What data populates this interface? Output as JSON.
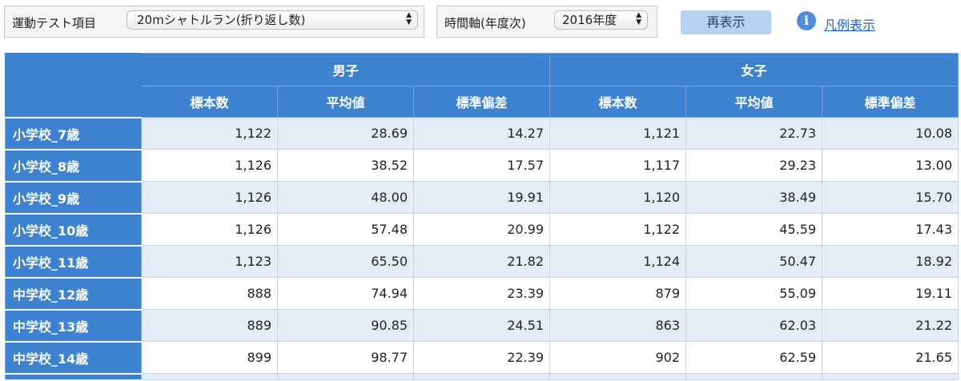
{
  "toolbar": {
    "test_item_label": "運動テスト項目",
    "test_item_value": "20mシャトルラン(折り返し数)",
    "time_axis_label": "時間軸(年度次)",
    "time_axis_value": "2016年度",
    "refresh_label": "再表示",
    "legend_label": "凡例表示",
    "info_glyph": "i"
  },
  "table": {
    "groups": [
      "男子",
      "女子"
    ],
    "columns": [
      "標本数",
      "平均値",
      "標準偏差",
      "標本数",
      "平均値",
      "標準偏差"
    ],
    "rows": [
      {
        "label": "小学校_7歳",
        "cells": [
          "1,122",
          "28.69",
          "14.27",
          "1,121",
          "22.73",
          "10.08"
        ]
      },
      {
        "label": "小学校_8歳",
        "cells": [
          "1,126",
          "38.52",
          "17.57",
          "1,117",
          "29.23",
          "13.00"
        ]
      },
      {
        "label": "小学校_9歳",
        "cells": [
          "1,126",
          "48.00",
          "19.91",
          "1,120",
          "38.49",
          "15.70"
        ]
      },
      {
        "label": "小学校_10歳",
        "cells": [
          "1,126",
          "57.48",
          "20.99",
          "1,122",
          "45.59",
          "17.43"
        ]
      },
      {
        "label": "小学校_11歳",
        "cells": [
          "1,123",
          "65.50",
          "21.82",
          "1,124",
          "50.47",
          "18.92"
        ]
      },
      {
        "label": "中学校_12歳",
        "cells": [
          "888",
          "74.94",
          "23.39",
          "879",
          "55.09",
          "19.11"
        ]
      },
      {
        "label": "中学校_13歳",
        "cells": [
          "889",
          "90.85",
          "24.51",
          "863",
          "62.03",
          "21.22"
        ]
      },
      {
        "label": "中学校_14歳",
        "cells": [
          "899",
          "98.77",
          "22.39",
          "902",
          "62.59",
          "21.65"
        ]
      }
    ]
  }
}
